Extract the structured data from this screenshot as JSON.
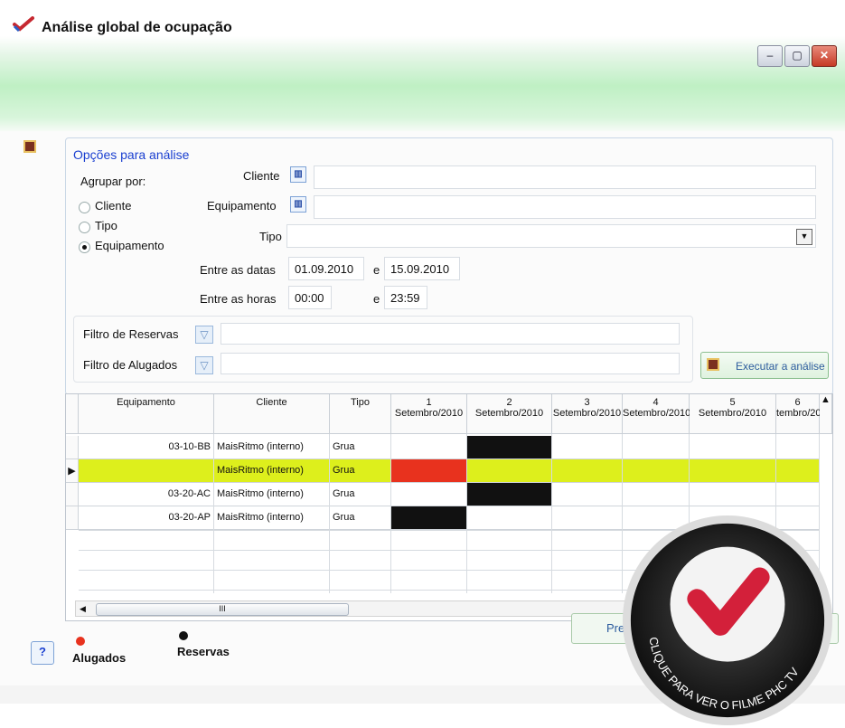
{
  "window": {
    "title": "Análise global de ocupação",
    "controls": [
      "–",
      "▢",
      "✕"
    ]
  },
  "options": {
    "section_title": "Opções para análise",
    "group_by_label": "Agrupar por:",
    "group_by_options": [
      "Cliente",
      "Tipo",
      "Equipamento"
    ],
    "group_by_selected": "Equipamento",
    "cliente_label": "Cliente",
    "cliente_value": "",
    "equipamento_label": "Equipamento",
    "equipamento_value": "",
    "tipo_label": "Tipo",
    "tipo_value": "",
    "dates_label": "Entre as datas",
    "date_from": "01.09.2010",
    "and_label": "e",
    "date_to": "15.09.2010",
    "hours_label": "Entre as horas",
    "hour_from": "00:00",
    "hour_to": "23:59",
    "filtro_reservas_label": "Filtro de Reservas",
    "filtro_reservas_value": "",
    "filtro_alugados_label": "Filtro de Alugados",
    "filtro_alugados_value": "",
    "execute_label": "Executar a análise"
  },
  "grid": {
    "headers": [
      {
        "top": "",
        "sub": "Equipamento"
      },
      {
        "top": "",
        "sub": "Cliente"
      },
      {
        "top": "",
        "sub": "Tipo"
      },
      {
        "top": "1",
        "sub": "Setembro/2010"
      },
      {
        "top": "2",
        "sub": "Setembro/2010"
      },
      {
        "top": "3",
        "sub": "Setembro/2010"
      },
      {
        "top": "4",
        "sub": "Setembro/2010"
      },
      {
        "top": "5",
        "sub": "Setembro/2010"
      },
      {
        "top": "6",
        "sub": "tembro/20"
      }
    ],
    "rows": [
      {
        "equipamento": "03-10-BB",
        "cliente": "MaisRitmo (interno)",
        "tipo": "Grua",
        "days": [
          "white",
          "black",
          "white",
          "white",
          "white",
          "white"
        ]
      },
      {
        "equipamento": "",
        "cliente": "MaisRitmo (interno)",
        "tipo": "Grua",
        "days": [
          "red",
          "yellow",
          "yellow",
          "yellow",
          "yellow",
          "yellow"
        ]
      },
      {
        "equipamento": "03-20-AC",
        "cliente": "MaisRitmo (interno)",
        "tipo": "Grua",
        "days": [
          "white",
          "black",
          "white",
          "white",
          "white",
          "white"
        ]
      },
      {
        "equipamento": "03-20-AP",
        "cliente": "MaisRitmo (interno)",
        "tipo": "Grua",
        "days": [
          "black",
          "white",
          "white",
          "white",
          "white",
          "white"
        ]
      }
    ],
    "scroll_thumb_label": "III"
  },
  "bottom_button_label": "Pre",
  "legend": {
    "alugados": "Alugados",
    "reservas": "Reservas"
  },
  "badge_text": "CLIQUE PARA VER O FILME PHC TV",
  "colors": {
    "alugado": "#e8321e",
    "reserva": "#111111",
    "highlight": "#ddef1c",
    "link_blue": "#1a3fd0"
  }
}
